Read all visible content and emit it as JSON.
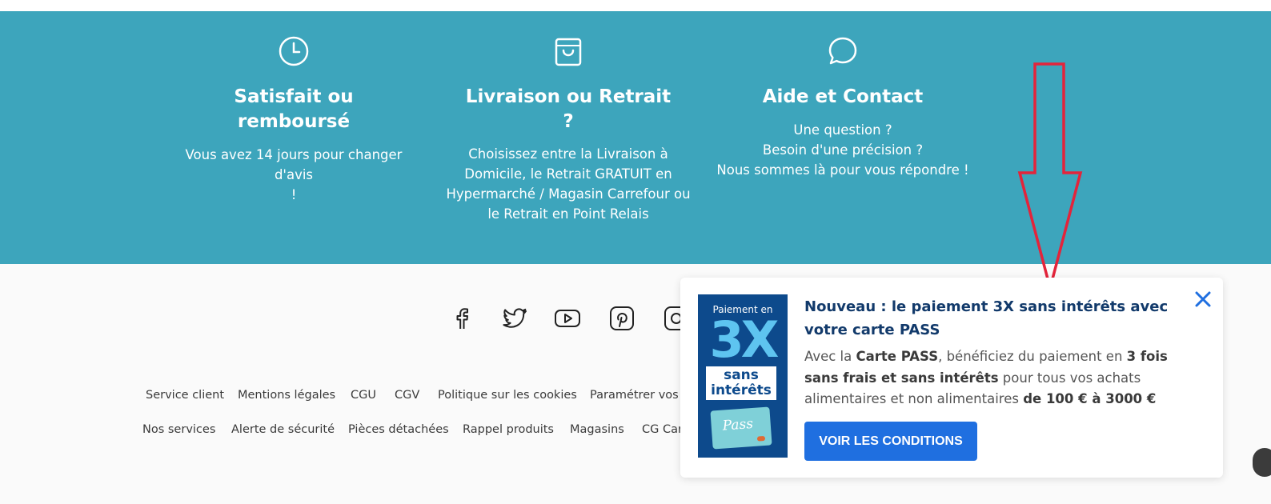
{
  "features": [
    {
      "title_line1": "Satisfait ou",
      "title_line2": "remboursé",
      "text": [
        "Vous avez 14 jours pour changer d'avis",
        "!"
      ],
      "icon": "clock-icon"
    },
    {
      "title_line1": "Livraison ou Retrait",
      "title_line2": "?",
      "text": [
        "Choisissez entre la Livraison à",
        "Domicile, le Retrait GRATUIT en",
        "Hypermarché / Magasin Carrefour ou",
        "le Retrait en Point Relais"
      ],
      "icon": "shopping-bag-icon"
    },
    {
      "title_line1": "Aide et Contact",
      "title_line2": "",
      "text": [
        "Une question ?",
        "Besoin d'une précision ?",
        "Nous sommes là pour vous répondre !"
      ],
      "icon": "chat-bubble-icon"
    }
  ],
  "socials": [
    "facebook-icon",
    "twitter-icon",
    "youtube-icon",
    "pinterest-icon",
    "instagram-icon"
  ],
  "footer_row1": [
    "Service client",
    "Mentions légales",
    "CGU",
    "CGV",
    "Politique sur les cookies",
    "Paramétrer vos c"
  ],
  "footer_row2": [
    "Nos services",
    "Alerte de sécurité",
    "Pièces détachées",
    "Rappel produits",
    "Magasins",
    "CG Car"
  ],
  "popup": {
    "card_top": "Paiement en",
    "card_big": "3X",
    "card_mid1": "sans",
    "card_mid2": "intérêts",
    "card_pass": "Pass",
    "title": "Nouveau : le paiement 3X sans intérêts avec votre carte PASS",
    "desc_1": "Avec la ",
    "desc_b1": "Carte PASS",
    "desc_2": ", bénéficiez du paiement en ",
    "desc_b2": "3 fois sans frais et sans intérêts",
    "desc_3": " pour tous vos achats alimentaires et non alimentaires ",
    "desc_b3": "de 100 € à 3000 €",
    "cta": "VOIR LES CONDITIONS"
  },
  "colors": {
    "banner": "#3da5bc",
    "cta": "#1f6fe0",
    "arrow": "#e3243b",
    "title": "#123a6b"
  }
}
